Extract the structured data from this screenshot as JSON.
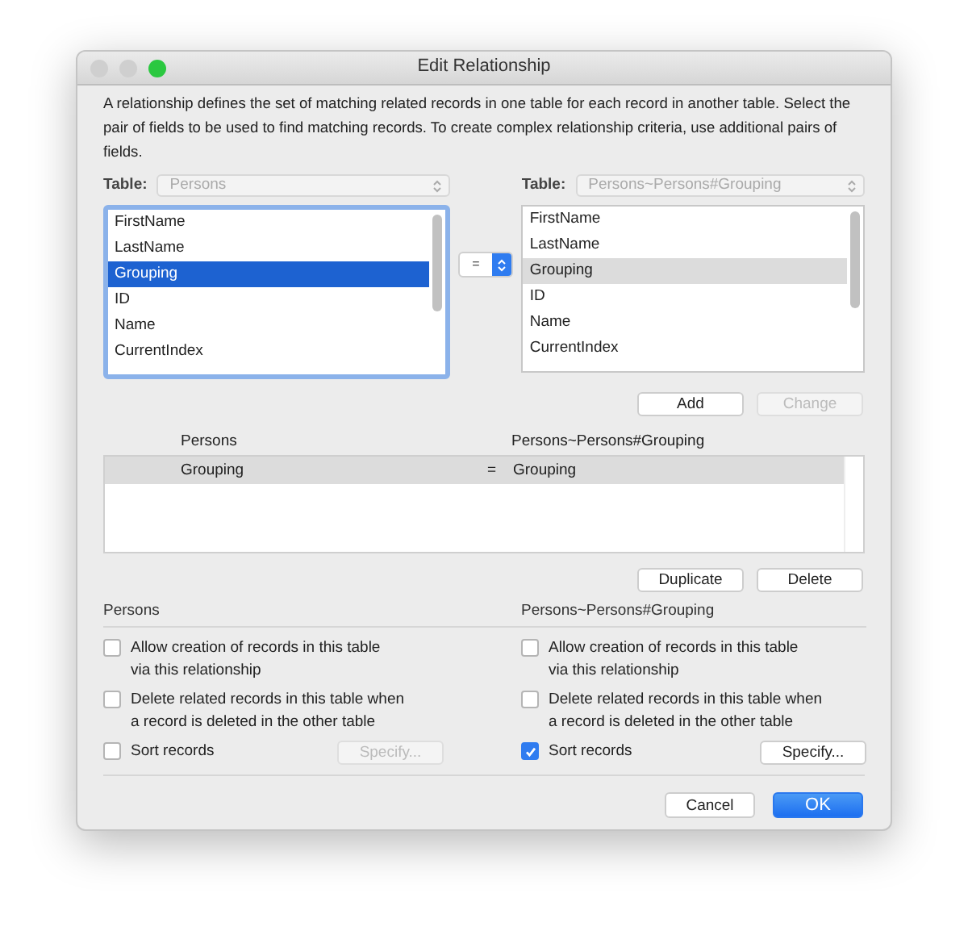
{
  "window": {
    "title": "Edit Relationship"
  },
  "description": "A relationship defines the set of matching related records in one table for each record in another table. Select the pair of fields to be used to find matching records. To create complex relationship criteria, use additional pairs of fields.",
  "left_table": {
    "label": "Table:",
    "value": "Persons",
    "disabled": true,
    "focused": true,
    "fields": [
      {
        "label": "FirstName",
        "selected": false
      },
      {
        "label": "LastName",
        "selected": false
      },
      {
        "label": "Grouping",
        "selected": true
      },
      {
        "label": "ID",
        "selected": false
      },
      {
        "label": "Name",
        "selected": false
      },
      {
        "label": "CurrentIndex",
        "selected": false
      }
    ]
  },
  "operator": "=",
  "right_table": {
    "label": "Table:",
    "value": "Persons~Persons#Grouping",
    "disabled": true,
    "focused": false,
    "fields": [
      {
        "label": "FirstName",
        "selected": false
      },
      {
        "label": "LastName",
        "selected": false
      },
      {
        "label": "Grouping",
        "selected": true
      },
      {
        "label": "ID",
        "selected": false
      },
      {
        "label": "Name",
        "selected": false
      },
      {
        "label": "CurrentIndex",
        "selected": false
      }
    ]
  },
  "field_buttons": [
    {
      "label": "Add",
      "disabled": false
    },
    {
      "label": "Change",
      "disabled": true
    }
  ],
  "criteria": {
    "columns": [
      "Persons",
      "Persons~Persons#Grouping"
    ],
    "rows": [
      {
        "left": "Grouping",
        "operator": "=",
        "right": "Grouping",
        "selected": true
      }
    ]
  },
  "criteria_buttons": [
    {
      "label": "Duplicate",
      "disabled": false
    },
    {
      "label": "Delete",
      "disabled": false
    }
  ],
  "options": [
    {
      "title": "Persons",
      "checkboxes": [
        {
          "label": "Allow creation of records in this table\nvia this relationship",
          "checked": false
        },
        {
          "label": "Delete related records in this table when\na record is deleted in the other table",
          "checked": false
        },
        {
          "label": "Sort records",
          "checked": false
        }
      ],
      "specify": {
        "label": "Specify...",
        "disabled": true
      }
    },
    {
      "title": "Persons~Persons#Grouping",
      "checkboxes": [
        {
          "label": "Allow creation of records in this table\nvia this relationship",
          "checked": false
        },
        {
          "label": "Delete related records in this table when\na record is deleted in the other table",
          "checked": false
        },
        {
          "label": "Sort records",
          "checked": true
        }
      ],
      "specify": {
        "label": "Specify...",
        "disabled": false
      }
    }
  ],
  "buttons": [
    {
      "label": "Cancel",
      "default": false
    },
    {
      "label": "OK",
      "default": true
    }
  ]
}
